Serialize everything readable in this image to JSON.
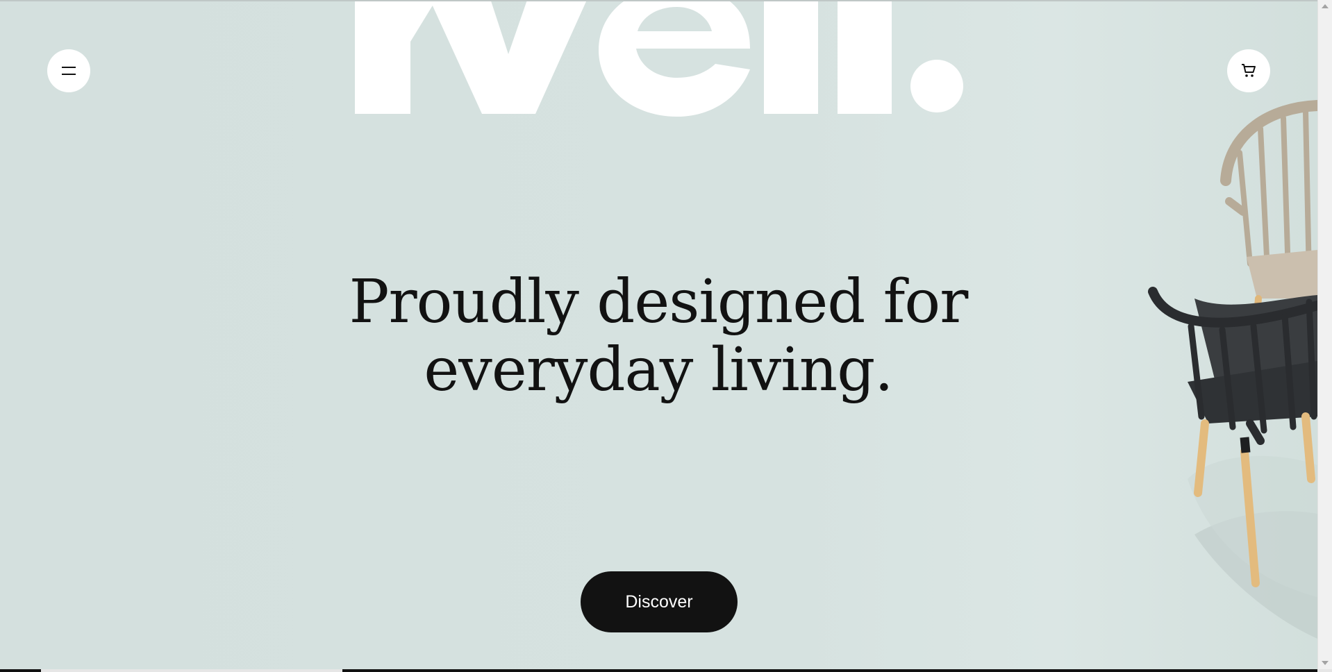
{
  "brand": {
    "logo_text": "rvell."
  },
  "header": {
    "menu_icon": "hamburger-icon",
    "cart_icon": "cart-icon"
  },
  "hero": {
    "headline_line1": "Proudly designed for",
    "headline_line2": "everyday living.",
    "cta_label": "Discover"
  },
  "colors": {
    "background": "#d6e2e0",
    "text": "#121212",
    "button": "#121212",
    "logo": "#ffffff"
  }
}
